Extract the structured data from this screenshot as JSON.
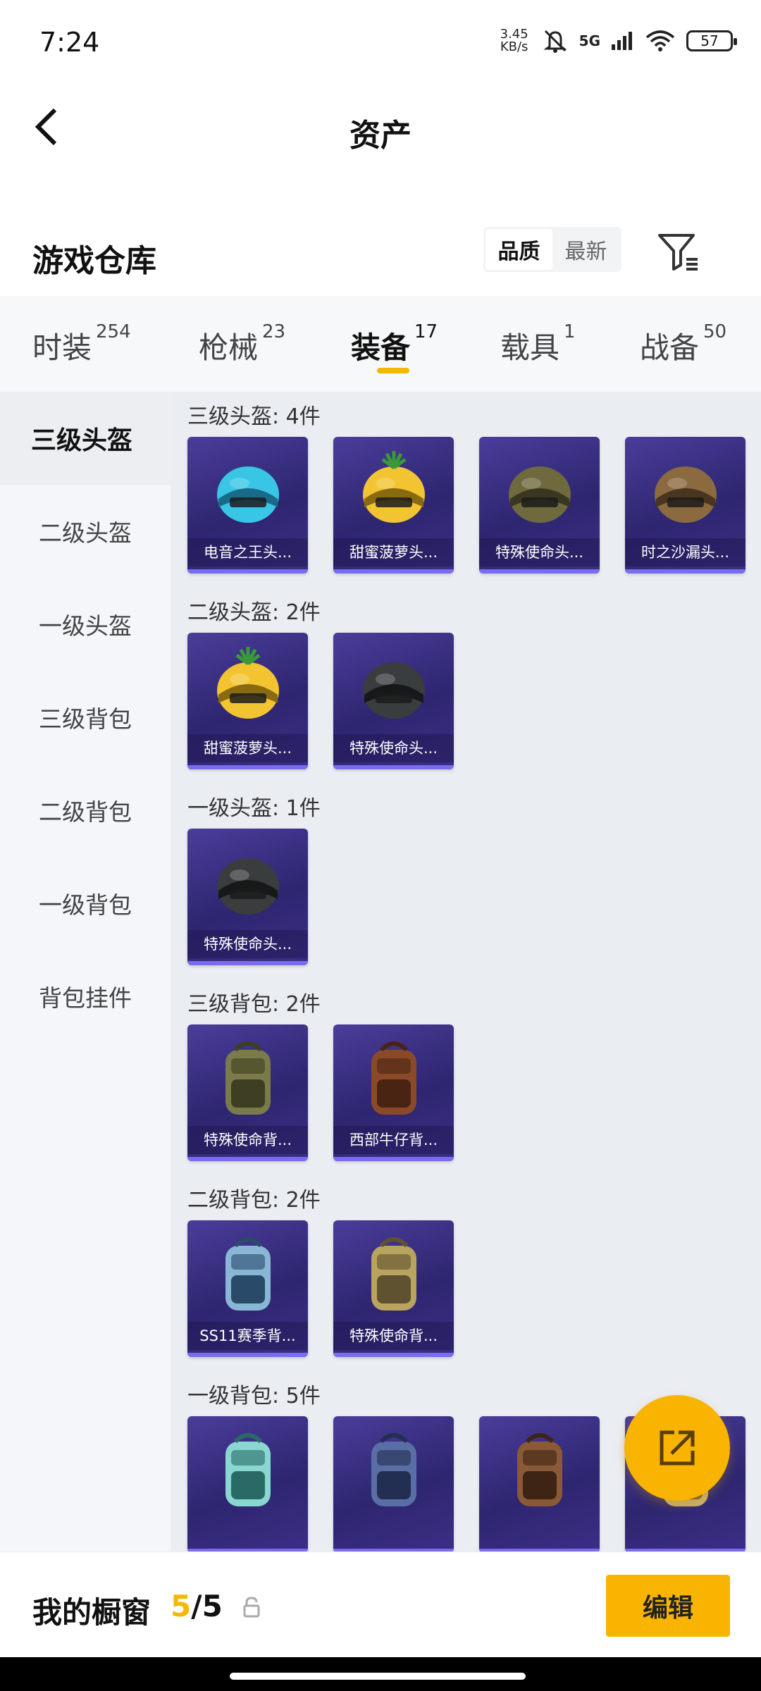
{
  "status_bar": {
    "time": "7:24",
    "net_speed_value": "3.45",
    "net_speed_unit": "KB/s",
    "network": "5G",
    "wifi_level": "7",
    "battery": "57"
  },
  "navbar": {
    "title": "资产"
  },
  "warehouse": {
    "title": "游戏仓库",
    "sort_options": [
      "品质",
      "最新"
    ],
    "active_sort": "品质"
  },
  "tabs": [
    {
      "label": "时装",
      "count": "254"
    },
    {
      "label": "枪械",
      "count": "23"
    },
    {
      "label": "装备",
      "count": "17",
      "active": true
    },
    {
      "label": "载具",
      "count": "1"
    },
    {
      "label": "战备",
      "count": "50"
    }
  ],
  "sidebar": {
    "items": [
      "三级头盔",
      "二级头盔",
      "一级头盔",
      "三级背包",
      "二级背包",
      "一级背包",
      "背包挂件"
    ],
    "active": "三级头盔"
  },
  "sections": [
    {
      "title": "三级头盔: 4件",
      "items": [
        {
          "name": "电音之王头...",
          "icon": "helmet-cyan-icon"
        },
        {
          "name": "甜蜜菠萝头...",
          "icon": "helmet-pineapple-icon"
        },
        {
          "name": "特殊使命头...",
          "icon": "helmet-olive-icon"
        },
        {
          "name": "时之沙漏头...",
          "icon": "helmet-bronze-icon"
        }
      ]
    },
    {
      "title": "二级头盔: 2件",
      "items": [
        {
          "name": "甜蜜菠萝头...",
          "icon": "helmet-pineapple-icon"
        },
        {
          "name": "特殊使命头...",
          "icon": "helmet-black-icon"
        }
      ]
    },
    {
      "title": "一级头盔: 1件",
      "items": [
        {
          "name": "特殊使命头...",
          "icon": "helmet-black-icon"
        }
      ]
    },
    {
      "title": "三级背包: 2件",
      "items": [
        {
          "name": "特殊使命背...",
          "icon": "backpack-olive-icon"
        },
        {
          "name": "西部牛仔背...",
          "icon": "backpack-brown-icon"
        }
      ]
    },
    {
      "title": "二级背包: 2件",
      "items": [
        {
          "name": "SS11赛季背...",
          "icon": "backpack-blue-icon"
        },
        {
          "name": "特殊使命背...",
          "icon": "backpack-khaki-icon"
        }
      ]
    },
    {
      "title": "一级背包: 5件",
      "items": [
        {
          "name": "",
          "icon": "backpack-teal-icon"
        },
        {
          "name": "",
          "icon": "backpack-navy-icon"
        },
        {
          "name": "",
          "icon": "backpack-leather-icon"
        },
        {
          "name": "",
          "icon": "backpack-gold-icon"
        }
      ]
    }
  ],
  "bottom_bar": {
    "label": "我的橱窗",
    "count_current": "5",
    "count_total": "/5",
    "edit_label": "编辑"
  },
  "colors": {
    "accent": "#f8b400",
    "card_bg": "#2e2670"
  }
}
